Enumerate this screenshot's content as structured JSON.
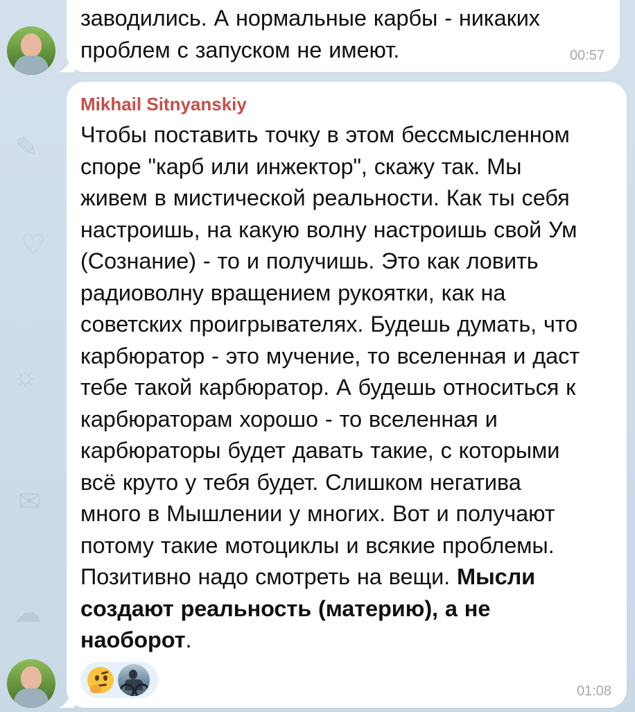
{
  "messages": [
    {
      "lines": [
        "заводились. А нормальные карбы - никаких",
        "проблем с запуском не имеют."
      ],
      "time": "00:57"
    },
    {
      "sender": "Mikhail Sitnyanskiy",
      "lines": [
        "Чтобы поставить точку в этом бессмысленном",
        "споре \"карб или инжектор\", скажу так. Мы",
        "живем в мистической реальности. Как ты себя",
        "настроишь, на какую волну настроишь свой Ум",
        "(Сознание) - то и получишь. Это как ловить",
        "радиоволну вращением рукоятки, как на",
        "советских проигрывателях. Будешь думать, что",
        "карбюратор - это мучение, то вселенная и даст",
        "тебе такой карбюратор. А будешь относиться к",
        "карбюраторам хорошо - то вселенная и",
        "карбюраторы будет давать такие, с которыми",
        "всё круто у тебя будет. Слишком негатива",
        "много в Мышлении у многих. Вот и получают",
        "потому такие мотоциклы и всякие проблемы.",
        "Позитивно надо смотреть на вещи."
      ],
      "bold_lines": [
        " Мысли",
        "создают реальность (материю), а не",
        "наоборот"
      ],
      "trailing": ".",
      "time": "01:08",
      "reactions": {
        "emoji_icon": "thinking-face-icon",
        "reactor_avatar": "motorcycle-rider-avatar"
      }
    }
  ],
  "colors": {
    "sender_name": "#c54f48",
    "bubble": "#ffffff",
    "background": "#cfdde8",
    "time": "#a5aab0",
    "reaction_pill": "#e6f1fb"
  }
}
